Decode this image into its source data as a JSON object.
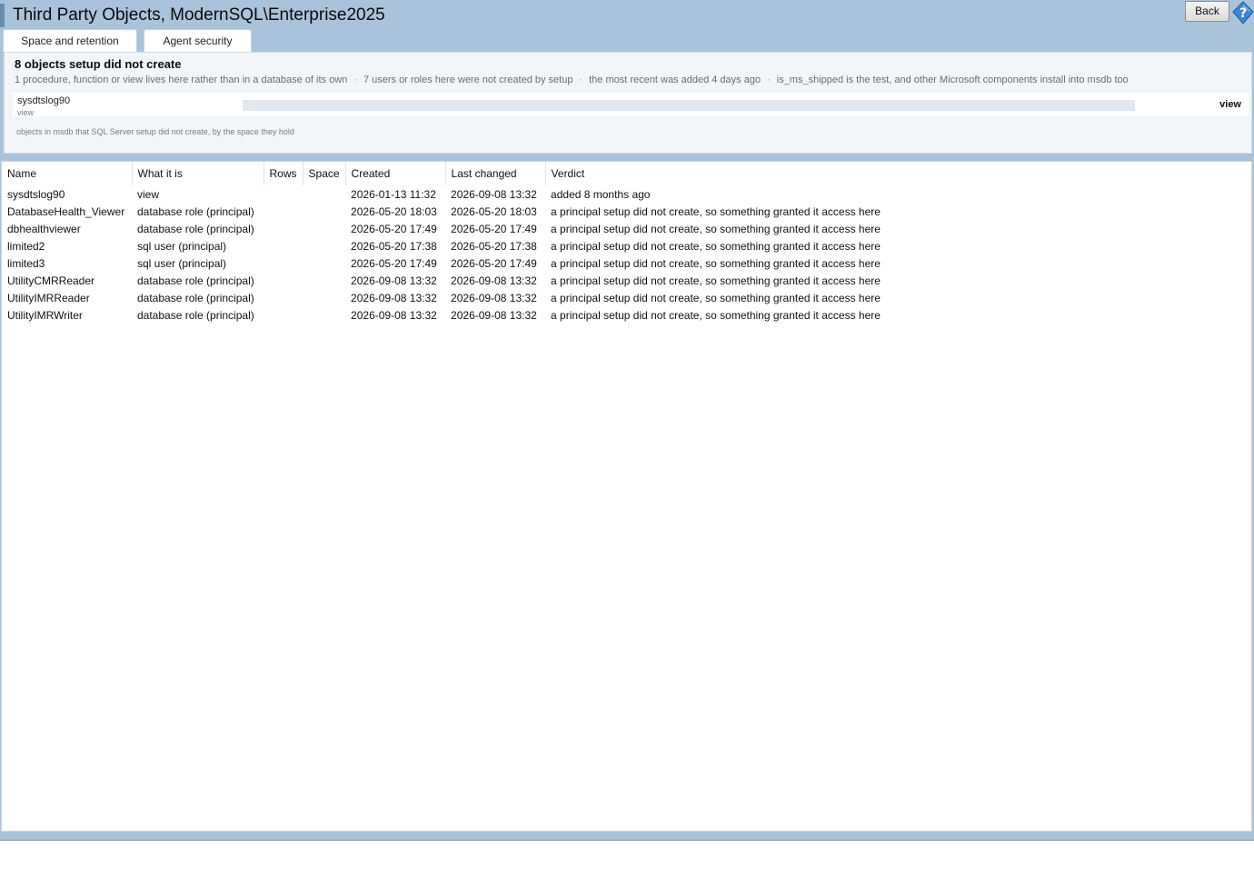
{
  "window": {
    "title": "Third Party Objects, ModernSQL\\Enterprise2025",
    "back_label": "Back",
    "help_icon": "help-question-icon"
  },
  "tabs": [
    {
      "label": "Space and retention"
    },
    {
      "label": "Agent security"
    }
  ],
  "summary": {
    "heading": "8 objects setup did not create",
    "facts": [
      "1 procedure, function or view lives here rather than in a database of its own",
      "7 users or roles here were not created by setup",
      "the most recent was added 4 days ago",
      "is_ms_shipped is the test, and other Microsoft components install into msdb too"
    ],
    "fact_separator": "·",
    "size_row": {
      "name": "sysdtslog90",
      "kind": "view",
      "tag": "view",
      "share": 0
    },
    "caption": "objects in msdb that SQL Server setup did not create, by the space they hold"
  },
  "grid": {
    "columns": [
      "Name",
      "What it is",
      "Rows",
      "Space",
      "Created",
      "Last changed",
      "Verdict"
    ],
    "rows": [
      [
        "sysdtslog90",
        "view",
        "",
        "",
        "2026-01-13 11:32",
        "2026-09-08 13:32",
        "added 8 months ago"
      ],
      [
        "DatabaseHealth_Viewer",
        "database role (principal)",
        "",
        "",
        "2026-05-20 18:03",
        "2026-05-20 18:03",
        "a principal setup did not create, so something granted it access here"
      ],
      [
        "dbhealthviewer",
        "database role (principal)",
        "",
        "",
        "2026-05-20 17:49",
        "2026-05-20 17:49",
        "a principal setup did not create, so something granted it access here"
      ],
      [
        "limited2",
        "sql user (principal)",
        "",
        "",
        "2026-05-20 17:38",
        "2026-05-20 17:38",
        "a principal setup did not create, so something granted it access here"
      ],
      [
        "limited3",
        "sql user (principal)",
        "",
        "",
        "2026-05-20 17:49",
        "2026-05-20 17:49",
        "a principal setup did not create, so something granted it access here"
      ],
      [
        "UtilityCMRReader",
        "database role (principal)",
        "",
        "",
        "2026-09-08 13:32",
        "2026-09-08 13:32",
        "a principal setup did not create, so something granted it access here"
      ],
      [
        "UtilityIMRReader",
        "database role (principal)",
        "",
        "",
        "2026-09-08 13:32",
        "2026-09-08 13:32",
        "a principal setup did not create, so something granted it access here"
      ],
      [
        "UtilityIMRWriter",
        "database role (principal)",
        "",
        "",
        "2026-09-08 13:32",
        "2026-09-08 13:32",
        "a principal setup did not create, so something granted it access here"
      ]
    ]
  },
  "colors": {
    "frame": "#a9c3db",
    "summary_bg": "#f3f6f9",
    "bar_track": "#e1e7ee"
  }
}
